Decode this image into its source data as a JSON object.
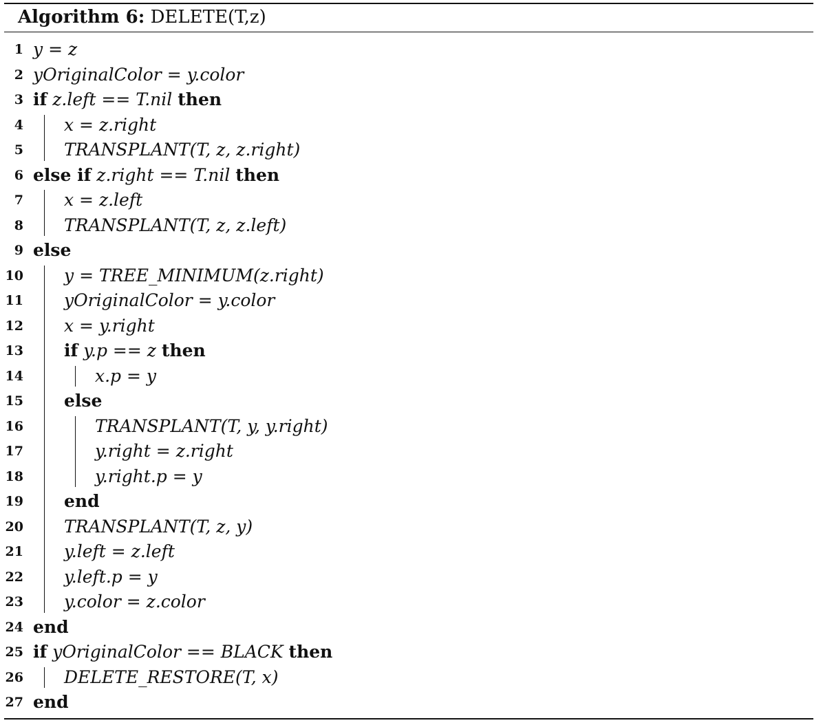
{
  "caption": {
    "label": "Algorithm 6:",
    "title": "DELETE(T,z)"
  },
  "lines": [
    {
      "num": "1",
      "indent": 0,
      "text": "y = z"
    },
    {
      "num": "2",
      "indent": 0,
      "text": "yOriginalColor = y.color"
    },
    {
      "num": "3",
      "indent": 0,
      "pre": "if",
      "text": "z.left == T.nil",
      "post": "then"
    },
    {
      "num": "4",
      "indent": 1,
      "text": "x = z.right"
    },
    {
      "num": "5",
      "indent": 1,
      "text": "TRANSPLANT(T, z, z.right)"
    },
    {
      "num": "6",
      "indent": 0,
      "pre": "else if",
      "text": "z.right == T.nil",
      "post": "then"
    },
    {
      "num": "7",
      "indent": 1,
      "text": "x = z.left"
    },
    {
      "num": "8",
      "indent": 1,
      "text": "TRANSPLANT(T, z, z.left)"
    },
    {
      "num": "9",
      "indent": 0,
      "pre": "else"
    },
    {
      "num": "10",
      "indent": 1,
      "text": "y = TREE_MINIMUM(z.right)"
    },
    {
      "num": "11",
      "indent": 1,
      "text": "yOriginalColor = y.color"
    },
    {
      "num": "12",
      "indent": 1,
      "text": "x = y.right"
    },
    {
      "num": "13",
      "indent": 1,
      "pre": "if",
      "text": "y.p == z",
      "post": "then"
    },
    {
      "num": "14",
      "indent": 2,
      "text": "x.p = y"
    },
    {
      "num": "15",
      "indent": 1,
      "pre": "else"
    },
    {
      "num": "16",
      "indent": 2,
      "text": "TRANSPLANT(T, y, y.right)"
    },
    {
      "num": "17",
      "indent": 2,
      "text": "y.right = z.right"
    },
    {
      "num": "18",
      "indent": 2,
      "text": "y.right.p = y"
    },
    {
      "num": "19",
      "indent": 1,
      "pre": "end"
    },
    {
      "num": "20",
      "indent": 1,
      "text": "TRANSPLANT(T, z, y)"
    },
    {
      "num": "21",
      "indent": 1,
      "text": "y.left = z.left"
    },
    {
      "num": "22",
      "indent": 1,
      "text": "y.left.p = y"
    },
    {
      "num": "23",
      "indent": 1,
      "text": "y.color = z.color"
    },
    {
      "num": "24",
      "indent": 0,
      "pre": "end"
    },
    {
      "num": "25",
      "indent": 0,
      "pre": "if",
      "text": "yOriginalColor == BLACK",
      "post": "then"
    },
    {
      "num": "26",
      "indent": 1,
      "text": "DELETE_RESTORE(T, x)"
    },
    {
      "num": "27",
      "indent": 0,
      "pre": "end"
    }
  ]
}
